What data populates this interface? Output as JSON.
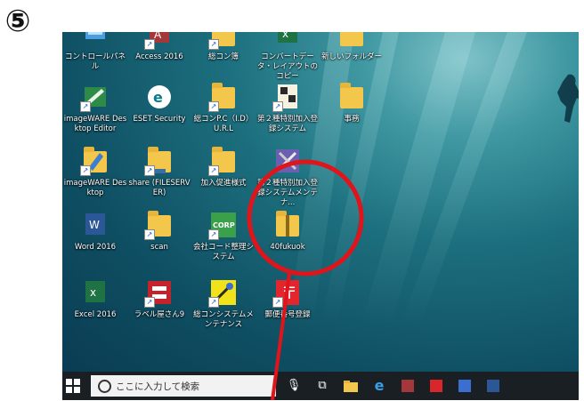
{
  "step_label": "⑤",
  "desktop_icons": [
    {
      "id": "control-panel",
      "label": "コントロールパネル",
      "icon": "control-panel-icon"
    },
    {
      "id": "access-2016",
      "label": "Access 2016",
      "icon": "access-icon"
    },
    {
      "id": "soukon-bo",
      "label": "総コン簿",
      "icon": "folder-icon"
    },
    {
      "id": "convert-data",
      "label": "コンバートデータ・レイアウトのコピー",
      "icon": "excel-icon"
    },
    {
      "id": "new-folder",
      "label": "新しいフォルダー",
      "icon": "folder-icon"
    },
    {
      "id": "imageware-editor",
      "label": "imageWARE Desktop Editor",
      "icon": "imageware-editor-icon"
    },
    {
      "id": "eset",
      "label": "ESET Security",
      "icon": "eset-icon"
    },
    {
      "id": "soukon-pc",
      "label": "総コンP.C（I.D）U.R.L",
      "icon": "folder-icon"
    },
    {
      "id": "type2-system",
      "label": "第２種特別加入登録システム",
      "icon": "type2-system-icon"
    },
    {
      "id": "jimu",
      "label": "事務",
      "icon": "folder-icon"
    },
    {
      "id": "imageware-desktop",
      "label": "imageWARE Desktop",
      "icon": "imageware-icon"
    },
    {
      "id": "share",
      "label": "share (FILESERVER)",
      "icon": "network-folder-icon"
    },
    {
      "id": "kanyu",
      "label": "加入促進様式",
      "icon": "folder-icon"
    },
    {
      "id": "type2-maint",
      "label": "第２種特別加入登録システムメンテナ...",
      "icon": "tools-icon"
    },
    {
      "id": "word",
      "label": "Word 2016",
      "icon": "word-icon"
    },
    {
      "id": "scan",
      "label": "scan",
      "icon": "folder-icon"
    },
    {
      "id": "company-code",
      "label": "会社コード整理システム",
      "icon": "corp-icon"
    },
    {
      "id": "fukuok",
      "label": "40fukuok",
      "icon": "zip-folder-icon"
    },
    {
      "id": "excel",
      "label": "Excel 2016",
      "icon": "excel-icon"
    },
    {
      "id": "label-maker",
      "label": "ラベル屋さん9",
      "icon": "label-icon"
    },
    {
      "id": "soukon-maint",
      "label": "総コンシステムメンテナンス",
      "icon": "tools-icon"
    },
    {
      "id": "postal",
      "label": "郵便番号登録",
      "icon": "postal-icon"
    }
  ],
  "taskbar": {
    "search_placeholder": "ここに入力して検索",
    "apps": [
      "microphone-icon",
      "task-view-icon",
      "file-explorer-icon",
      "edge-icon",
      "access-icon",
      "acrobat-icon",
      "pin-icon",
      "word-icon"
    ]
  },
  "colors": {
    "highlight": "#e0141b",
    "taskbar": "#1a1f24"
  }
}
